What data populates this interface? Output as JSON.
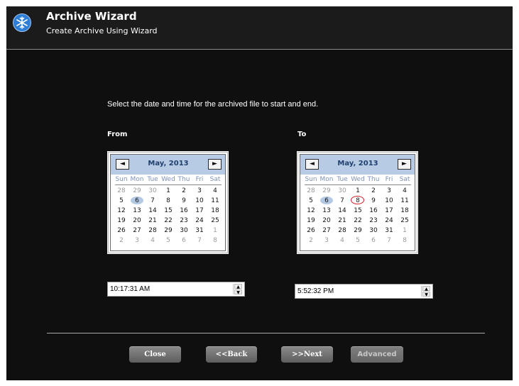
{
  "window": {
    "title": "Archive Wizard",
    "subtitle": "Create Archive Using Wizard"
  },
  "instruction": "Select the date and time for the archived file to start and end.",
  "from": {
    "label": "From",
    "calendar": {
      "month_label": "May, 2013",
      "prev": "◄",
      "next": "►",
      "weekdays": [
        "Sun",
        "Mon",
        "Tue",
        "Wed",
        "Thu",
        "Fri",
        "Sat"
      ],
      "weeks": [
        [
          "28",
          "29",
          "30",
          "1",
          "2",
          "3",
          "4"
        ],
        [
          "5",
          "6",
          "7",
          "8",
          "9",
          "10",
          "11"
        ],
        [
          "12",
          "13",
          "14",
          "15",
          "16",
          "17",
          "18"
        ],
        [
          "19",
          "20",
          "21",
          "22",
          "23",
          "24",
          "25"
        ],
        [
          "26",
          "27",
          "28",
          "29",
          "30",
          "31",
          "1"
        ],
        [
          "2",
          "3",
          "4",
          "5",
          "6",
          "7",
          "8"
        ]
      ],
      "today": "6",
      "selected": "6"
    },
    "time": "10:17:31 AM"
  },
  "to": {
    "label": "To",
    "calendar": {
      "month_label": "May, 2013",
      "prev": "◄",
      "next": "►",
      "weekdays": [
        "Sun",
        "Mon",
        "Tue",
        "Wed",
        "Thu",
        "Fri",
        "Sat"
      ],
      "weeks": [
        [
          "28",
          "29",
          "30",
          "1",
          "2",
          "3",
          "4"
        ],
        [
          "5",
          "6",
          "7",
          "8",
          "9",
          "10",
          "11"
        ],
        [
          "12",
          "13",
          "14",
          "15",
          "16",
          "17",
          "18"
        ],
        [
          "19",
          "20",
          "21",
          "22",
          "23",
          "24",
          "25"
        ],
        [
          "26",
          "27",
          "28",
          "29",
          "30",
          "31",
          "1"
        ],
        [
          "2",
          "3",
          "4",
          "5",
          "6",
          "7",
          "8"
        ]
      ],
      "today": "6",
      "selected": "8"
    },
    "time": "5:52:32 PM"
  },
  "buttons": {
    "close": "Close",
    "back": "<<Back",
    "next": ">>Next",
    "advanced": "Advanced"
  },
  "colors": {
    "window_bg": "#0f0f0f",
    "calendar_header": "#b7cbe5",
    "today_highlight": "#b3c8e3",
    "selected_circle": "#d0202a"
  },
  "icons": {
    "logo": "snowflake-logo-icon",
    "prev": "triangle-left-icon",
    "next": "triangle-right-icon",
    "spin_up": "spin-up-icon",
    "spin_down": "spin-down-icon"
  }
}
